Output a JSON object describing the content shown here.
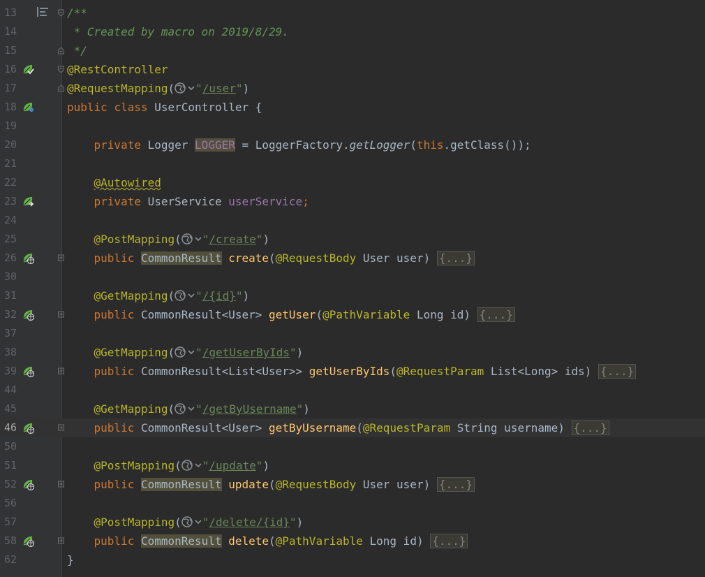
{
  "editor": {
    "current_line": "46",
    "lines": [
      {
        "n": "13"
      },
      {
        "n": "14"
      },
      {
        "n": "15"
      },
      {
        "n": "16"
      },
      {
        "n": "17"
      },
      {
        "n": "18"
      },
      {
        "n": "19"
      },
      {
        "n": "20"
      },
      {
        "n": "21"
      },
      {
        "n": "22"
      },
      {
        "n": "23"
      },
      {
        "n": "24"
      },
      {
        "n": "25"
      },
      {
        "n": "26"
      },
      {
        "n": "30"
      },
      {
        "n": "31"
      },
      {
        "n": "32"
      },
      {
        "n": "37"
      },
      {
        "n": "38"
      },
      {
        "n": "39"
      },
      {
        "n": "44"
      },
      {
        "n": "45"
      },
      {
        "n": "46"
      },
      {
        "n": "50"
      },
      {
        "n": "51"
      },
      {
        "n": "52"
      },
      {
        "n": "56"
      },
      {
        "n": "57"
      },
      {
        "n": "58"
      },
      {
        "n": "62"
      }
    ],
    "code": {
      "doc_open": "/**",
      "doc_text": " * Created by macro on 2019/8/29.",
      "doc_close": " */",
      "rest_controller": "@RestController",
      "request_mapping": "@RequestMapping",
      "request_mapping_path": "/user",
      "kw_public": "public",
      "kw_class": "class",
      "class_name": "UserController",
      "kw_private": "private",
      "type_logger": "Logger",
      "field_logger": "LOGGER",
      "logger_factory": "LoggerFactory.",
      "get_logger": "getLogger",
      "kw_this": "this",
      "get_class": ".getClass());",
      "autowired": "@Autowired",
      "type_user_service": "UserService",
      "field_user_service": "userService",
      "post_mapping": "@PostMapping",
      "get_mapping": "@GetMapping",
      "path_create": "/create",
      "path_id": "/{id}",
      "path_get_user_by_ids": "/getUserByIds",
      "path_get_by_username": "/getByUsername",
      "path_update": "/update",
      "path_delete": "/delete/{id}",
      "type_common_result": "CommonResult",
      "type_common_result_user": "CommonResult<User>",
      "type_common_result_list_user": "CommonResult<List<User>>",
      "fn_create": "create",
      "fn_get_user": "getUser",
      "fn_get_user_by_ids": "getUserByIds",
      "fn_get_by_username": "getByUsername",
      "fn_update": "update",
      "fn_delete": "delete",
      "ann_request_body": "@RequestBody",
      "ann_path_variable": "@PathVariable",
      "ann_request_param": "@RequestParam",
      "param_user": "User user)",
      "param_long_id": "Long id)",
      "param_list_ids": "List<Long> ids)",
      "param_username": "String username)",
      "folded_body": "{...}",
      "close_brace": "}"
    }
  },
  "icons": {
    "bean": "spring-bean-icon",
    "web": "globe-icon",
    "fold": "fold-icon"
  },
  "colors": {
    "background": "#2b2b2b",
    "gutter": "#313335",
    "keyword": "#cc7832",
    "annotation": "#bbb529",
    "string": "#6a8759",
    "doc_comment": "#629755",
    "field": "#9876aa",
    "method": "#ffc66d",
    "spring_icon": "#62b543"
  }
}
